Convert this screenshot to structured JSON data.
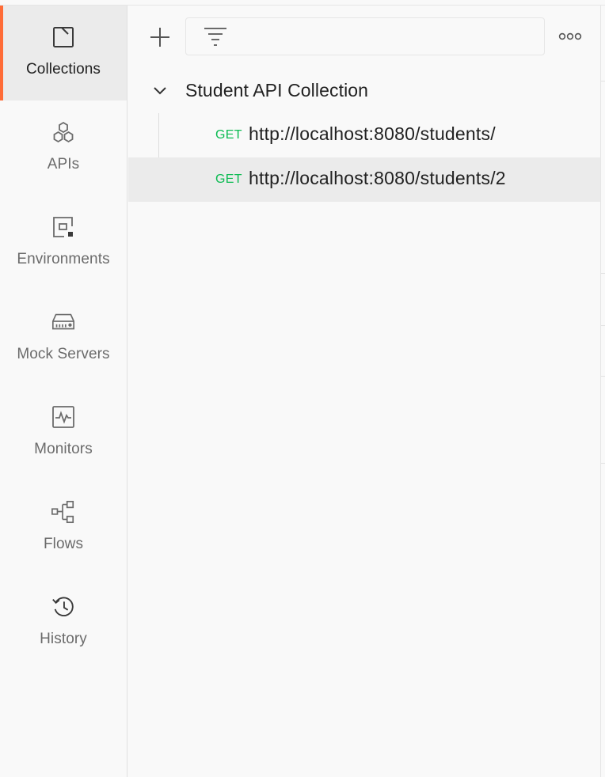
{
  "nav": {
    "items": [
      {
        "label": "Collections",
        "icon": "collections-icon",
        "active": true
      },
      {
        "label": "APIs",
        "icon": "apis-icon"
      },
      {
        "label": "Environments",
        "icon": "environments-icon"
      },
      {
        "label": "Mock Servers",
        "icon": "mock-servers-icon"
      },
      {
        "label": "Monitors",
        "icon": "monitors-icon"
      },
      {
        "label": "Flows",
        "icon": "flows-icon"
      },
      {
        "label": "History",
        "icon": "history-icon"
      }
    ]
  },
  "toolbar": {
    "search_value": "",
    "search_placeholder": ""
  },
  "collection": {
    "name": "Student API Collection",
    "expanded": true,
    "requests": [
      {
        "method": "GET",
        "url": "http://localhost:8080/students/",
        "selected": false
      },
      {
        "method": "GET",
        "url": "http://localhost:8080/students/2",
        "selected": true
      }
    ]
  },
  "colors": {
    "accent": "#ff6c37",
    "method_get": "#0cbb52",
    "selected_bg": "#ebebeb",
    "background": "#f9f9f9"
  }
}
